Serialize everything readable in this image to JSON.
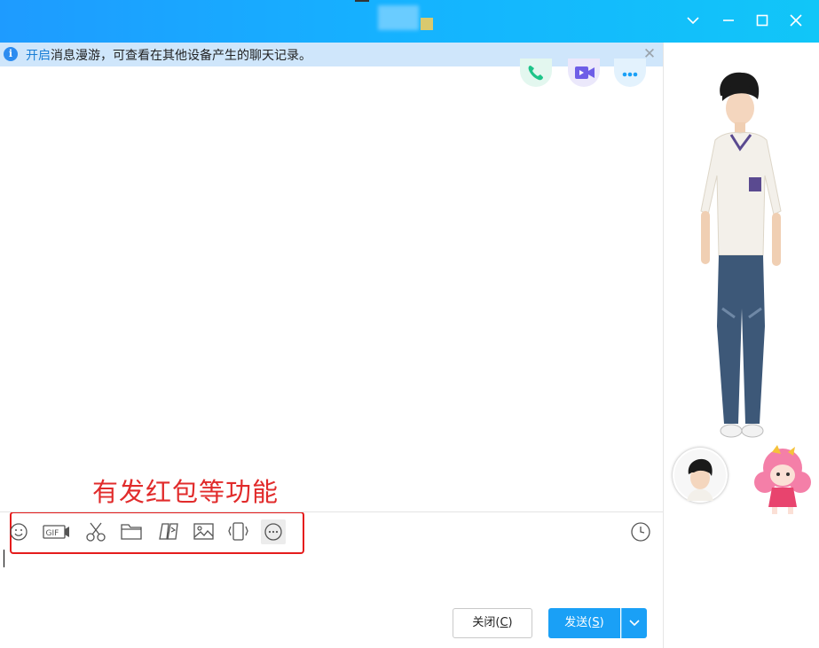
{
  "titlebar": {
    "icons": [
      "chevron-down-icon",
      "minimize-icon",
      "maximize-icon",
      "close-icon"
    ]
  },
  "banner": {
    "link_text": "开启",
    "message": "消息漫游，可查看在其他设备产生的聊天记录。"
  },
  "header_actions": [
    {
      "name": "voice-call-icon",
      "color": "#1dc489"
    },
    {
      "name": "video-call-icon",
      "color": "#6e5ee7"
    },
    {
      "name": "more-icon",
      "color": "#1aa0f6"
    }
  ],
  "annotation": {
    "text": "有发红包等功能",
    "color": "#e12b2b"
  },
  "toolbar": {
    "tools": [
      "emoji-icon",
      "gif-icon",
      "screenshot-scissors-icon",
      "folder-icon",
      "screen-record-icon",
      "image-icon",
      "shake-window-icon",
      "more-options-icon"
    ],
    "gif_label": "GIF",
    "history_icon": "clock-icon"
  },
  "buttons": {
    "close_label": "关闭(",
    "close_key": "C",
    "close_end": ")",
    "send_label": "发送(",
    "send_key": "S",
    "send_end": ")"
  },
  "colors": {
    "accent": "#1aa0f6",
    "banner_bg": "#cfe6fb"
  }
}
